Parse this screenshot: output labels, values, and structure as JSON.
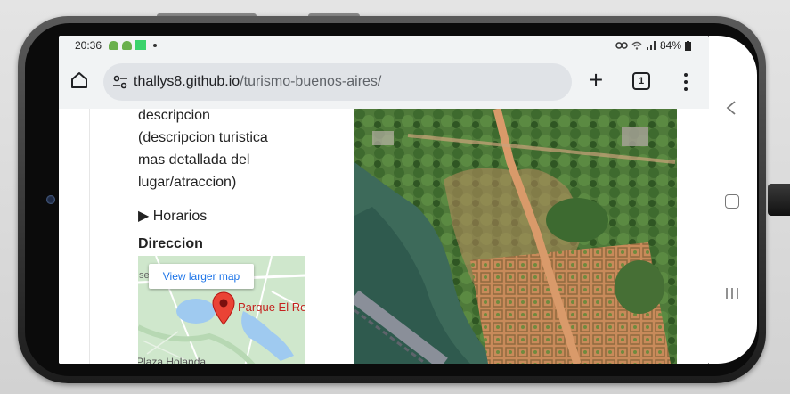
{
  "status_bar": {
    "time": "20:36",
    "right": "84%"
  },
  "browser": {
    "url_host": "thallys8.github.io",
    "url_path": "/turismo-buenos-aires/",
    "tab_count": "1"
  },
  "page": {
    "description_lines": [
      "descripcion",
      "(descripcion turistica",
      "mas detallada del",
      "lugar/atraccion)"
    ],
    "horarios_label": "▶ Horarios",
    "direccion_title": "Direccion",
    "map": {
      "larger_map_label": "View larger map",
      "edge_text": "se",
      "place_label": "Parque El Ro",
      "plaza_label": "Plaza Holanda"
    }
  },
  "colors": {
    "browser_chrome": "#f1f3f4",
    "url_pill": "#e0e3e7",
    "link_blue": "#1a73e8",
    "pin_red": "#ea4335"
  },
  "icons": {
    "home": "home-icon",
    "site_info": "tune-icon",
    "new_tab": "plus-icon",
    "tabs": "tab-switcher-icon",
    "menu": "kebab-menu-icon",
    "back": "chevron-left-icon",
    "nav_home": "square-home-icon",
    "recents": "recent-apps-icon"
  }
}
